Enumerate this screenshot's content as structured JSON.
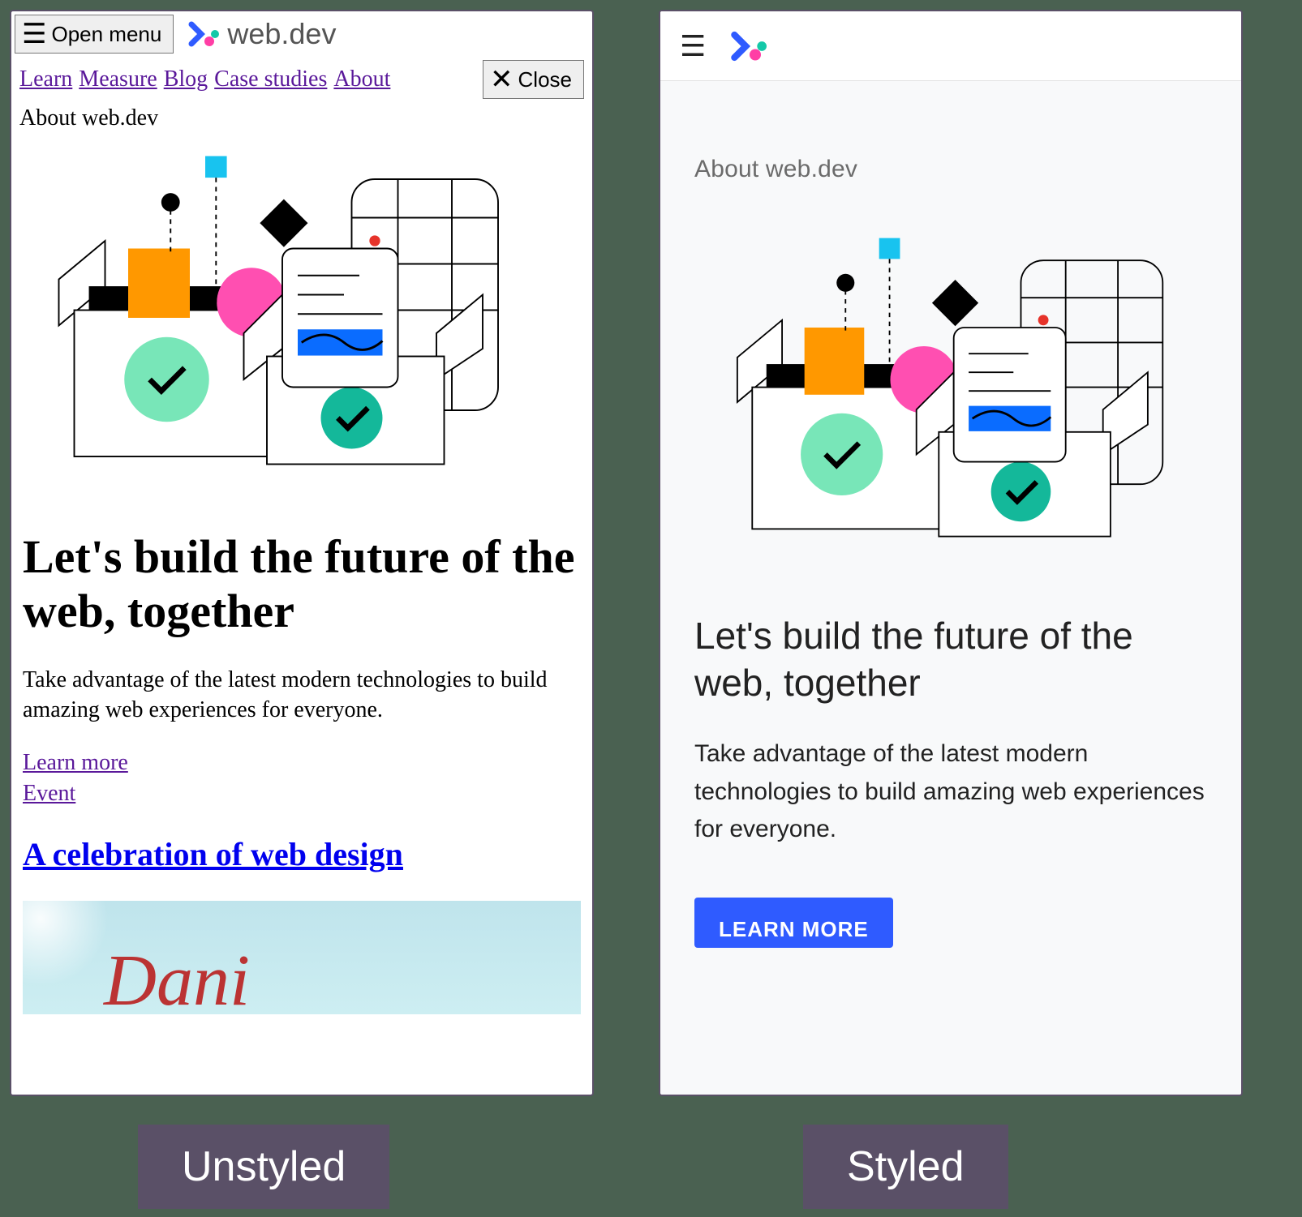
{
  "captions": {
    "left": "Unstyled",
    "right": "Styled"
  },
  "brand": {
    "name": "web.dev"
  },
  "unstyled": {
    "open_menu_label": "Open menu",
    "close_label": "Close",
    "nav": {
      "learn": "Learn",
      "measure": "Measure",
      "blog": "Blog",
      "case_studies": "Case studies",
      "about": "About"
    },
    "eyebrow": "About web.dev",
    "heading": "Let's build the future of the web, together",
    "tagline": "Take advantage of the latest modern technologies to build amazing web experiences for everyone.",
    "links": {
      "learn_more": "Learn more",
      "event": "Event"
    },
    "subheading": "A celebration of web design"
  },
  "styled": {
    "eyebrow": "About web.dev",
    "heading": "Let's build the future of the web, together",
    "tagline": "Take advantage of the latest modern technologies to build amazing web experiences for everyone.",
    "cta": "LEARN MORE"
  }
}
